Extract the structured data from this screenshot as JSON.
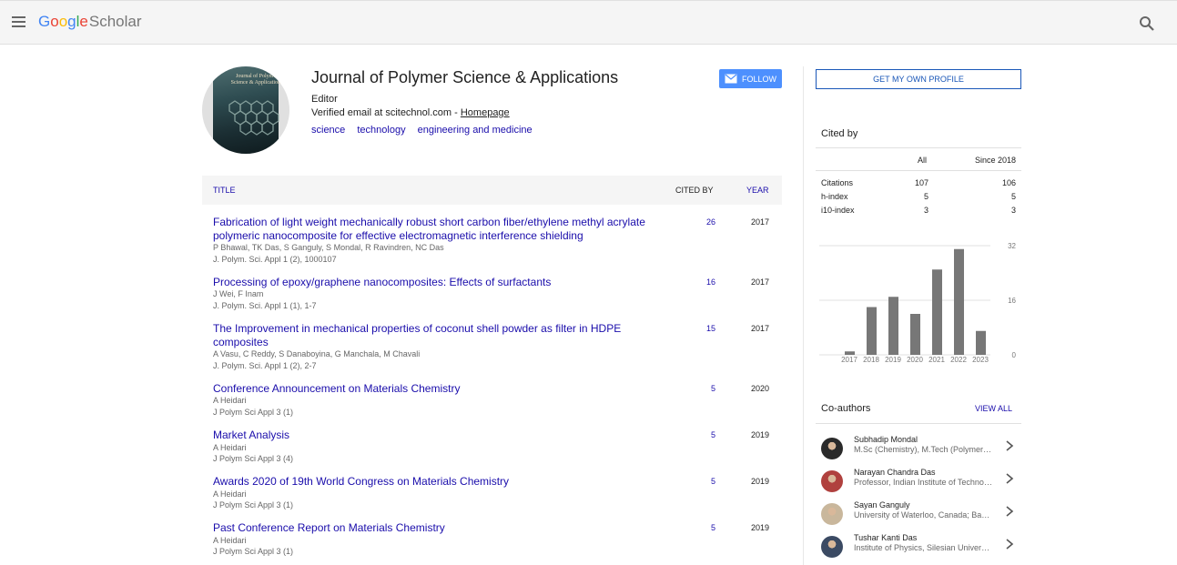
{
  "header": {
    "logo_letters": [
      {
        "ch": "G",
        "color": "#4285f4"
      },
      {
        "ch": "o",
        "color": "#ea4335"
      },
      {
        "ch": "o",
        "color": "#fbbc05"
      },
      {
        "ch": "g",
        "color": "#4285f4"
      },
      {
        "ch": "l",
        "color": "#34a853"
      },
      {
        "ch": "e",
        "color": "#ea4335"
      }
    ],
    "logo_suffix": "Scholar",
    "menu_icon": "hamburger-icon",
    "search_icon": "search-icon"
  },
  "profile": {
    "avatar_text": "Journal of Polymer Science & Applications",
    "name": "Journal of Polymer Science & Applications",
    "affiliation": "Editor",
    "email_prefix": "Verified email at scitechnol.com - ",
    "homepage_label": "Homepage",
    "interests": [
      "science",
      "technology",
      "engineering and medicine"
    ],
    "follow_label": "FOLLOW"
  },
  "table": {
    "headers": {
      "title": "TITLE",
      "cited_by": "CITED BY",
      "year": "YEAR"
    },
    "rows": [
      {
        "title": "Fabrication of light weight mechanically robust short carbon fiber/ethylene methyl acrylate polymeric nanocomposite for effective electromagnetic interference shielding",
        "authors": "P Bhawal, TK Das, S Ganguly, S Mondal, R Ravindren, NC Das",
        "venue": "J. Polym. Sci. Appl 1 (2), 1000107",
        "cited": "26",
        "year": "2017"
      },
      {
        "title": "Processing of epoxy/graphene nanocomposites: Effects of surfactants",
        "authors": "J Wei, F Inam",
        "venue": "J. Polym. Sci. Appl 1 (1), 1-7",
        "cited": "16",
        "year": "2017"
      },
      {
        "title": "The Improvement in mechanical properties of coconut shell powder as filter in HDPE composites",
        "authors": "A Vasu, C Reddy, S Danaboyina, G Manchala, M Chavali",
        "venue": "J. Polym. Sci. Appl 1 (2), 2-7",
        "cited": "15",
        "year": "2017"
      },
      {
        "title": "Conference Announcement on Materials Chemistry",
        "authors": "A Heidari",
        "venue": "J Polym Sci Appl 3 (1)",
        "cited": "5",
        "year": "2020"
      },
      {
        "title": "Market Analysis",
        "authors": "A Heidari",
        "venue": "J Polym Sci Appl 3 (4)",
        "cited": "5",
        "year": "2019"
      },
      {
        "title": "Awards 2020 of 19th World Congress on Materials Chemistry",
        "authors": "A Heidari",
        "venue": "J Polym Sci Appl 3 (1)",
        "cited": "5",
        "year": "2019"
      },
      {
        "title": "Past Conference Report on Materials Chemistry",
        "authors": "A Heidari",
        "venue": "J Polym Sci Appl 3 (1)",
        "cited": "5",
        "year": "2019"
      }
    ]
  },
  "sidebar": {
    "own_profile_label": "GET MY OWN PROFILE",
    "cited_by_title": "Cited by",
    "col_all": "All",
    "col_since": "Since 2018",
    "metrics": [
      {
        "label": "Citations",
        "all": "107",
        "since": "106"
      },
      {
        "label": "h-index",
        "all": "5",
        "since": "5"
      },
      {
        "label": "i10-index",
        "all": "3",
        "since": "3"
      }
    ],
    "coauthors_title": "Co-authors",
    "view_all_label": "VIEW ALL",
    "coauthors": [
      {
        "name": "Subhadip Mondal",
        "affiliation": "M.Sc (Chemistry), M.Tech (Polymer Science and Technology)",
        "avatar_color": "#2a2a2a"
      },
      {
        "name": "Narayan Chandra Das",
        "affiliation": "Professor, Indian Institute of Technology Kharagpur",
        "avatar_color": "#b0413e"
      },
      {
        "name": "Sayan Ganguly",
        "affiliation": "University of Waterloo, Canada; Bar-Ilan University",
        "avatar_color": "#c9b79c"
      },
      {
        "name": "Tushar Kanti Das",
        "affiliation": "Institute of Physics, Silesian University of Technology",
        "avatar_color": "#3b4a63"
      }
    ]
  },
  "chart_data": {
    "type": "bar",
    "categories": [
      "2017",
      "2018",
      "2019",
      "2020",
      "2021",
      "2022",
      "2023"
    ],
    "x": [
      2017,
      2017.5,
      2018,
      2019,
      2020,
      2021,
      2022,
      2023
    ],
    "values": [
      1,
      14,
      17,
      12,
      25,
      31,
      7
    ],
    "year_positions": [
      2017,
      2018,
      2019,
      2020,
      2021,
      2022,
      2023
    ],
    "yticks": [
      "0",
      "16",
      "32"
    ],
    "ylim": [
      0,
      32
    ],
    "bar_color": "#777777",
    "grid": true
  }
}
